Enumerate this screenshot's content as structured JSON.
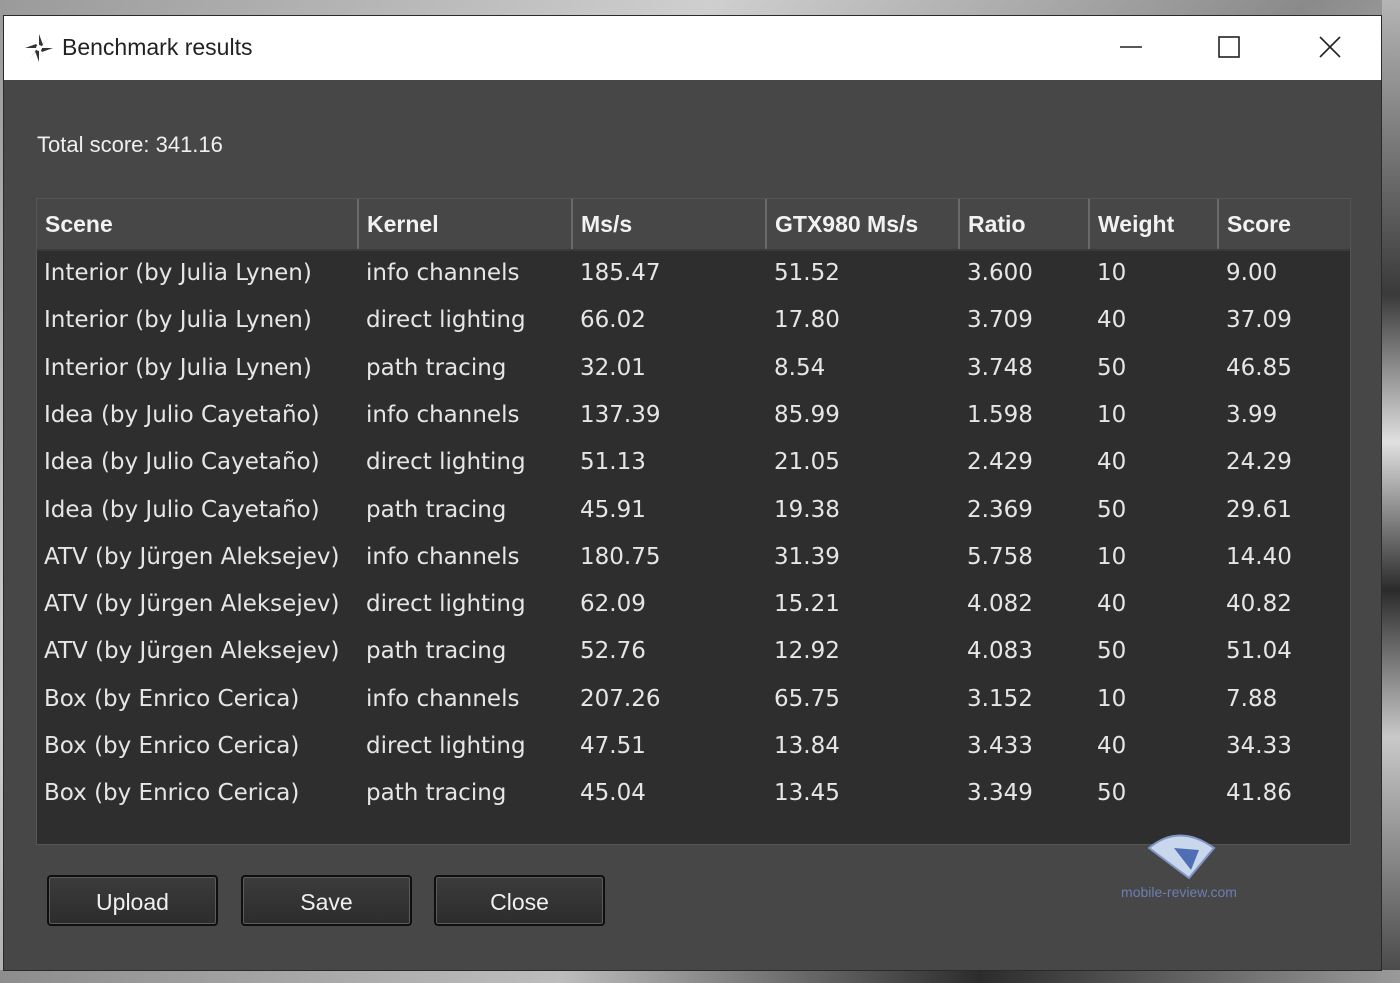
{
  "window": {
    "title": "Benchmark results",
    "controls": [
      "minimize",
      "maximize",
      "close"
    ]
  },
  "summary": {
    "total_score": "Total score: 341.16"
  },
  "table": {
    "columns": [
      "Scene",
      "Kernel",
      "Ms/s",
      "GTX980 Ms/s",
      "Ratio",
      "Weight",
      "Score"
    ],
    "rows": [
      [
        "Interior (by Julia Lynen)",
        "info channels",
        "185.47",
        "51.52",
        "3.600",
        "10",
        "9.00"
      ],
      [
        "Interior (by Julia Lynen)",
        "direct lighting",
        "66.02",
        "17.80",
        "3.709",
        "40",
        "37.09"
      ],
      [
        "Interior (by Julia Lynen)",
        "path tracing",
        "32.01",
        "8.54",
        "3.748",
        "50",
        "46.85"
      ],
      [
        "Idea (by Julio Cayetaño)",
        "info channels",
        "137.39",
        "85.99",
        "1.598",
        "10",
        "3.99"
      ],
      [
        "Idea (by Julio Cayetaño)",
        "direct lighting",
        "51.13",
        "21.05",
        "2.429",
        "40",
        "24.29"
      ],
      [
        "Idea (by Julio Cayetaño)",
        "path tracing",
        "45.91",
        "19.38",
        "2.369",
        "50",
        "29.61"
      ],
      [
        "ATV (by Jürgen Aleksejev)",
        "info channels",
        "180.75",
        "31.39",
        "5.758",
        "10",
        "14.40"
      ],
      [
        "ATV (by Jürgen Aleksejev)",
        "direct lighting",
        "62.09",
        "15.21",
        "4.082",
        "40",
        "40.82"
      ],
      [
        "ATV (by Jürgen Aleksejev)",
        "path tracing",
        "52.76",
        "12.92",
        "4.083",
        "50",
        "51.04"
      ],
      [
        "Box (by Enrico Cerica)",
        "info channels",
        "207.26",
        "65.75",
        "3.152",
        "10",
        "7.88"
      ],
      [
        "Box (by Enrico Cerica)",
        "direct lighting",
        "47.51",
        "13.84",
        "3.433",
        "40",
        "34.33"
      ],
      [
        "Box (by Enrico Cerica)",
        "path tracing",
        "45.04",
        "13.45",
        "3.349",
        "50",
        "41.86"
      ]
    ]
  },
  "buttons": {
    "upload": "Upload",
    "save": "Save",
    "close": "Close"
  },
  "watermark": "mobile-review.com"
}
